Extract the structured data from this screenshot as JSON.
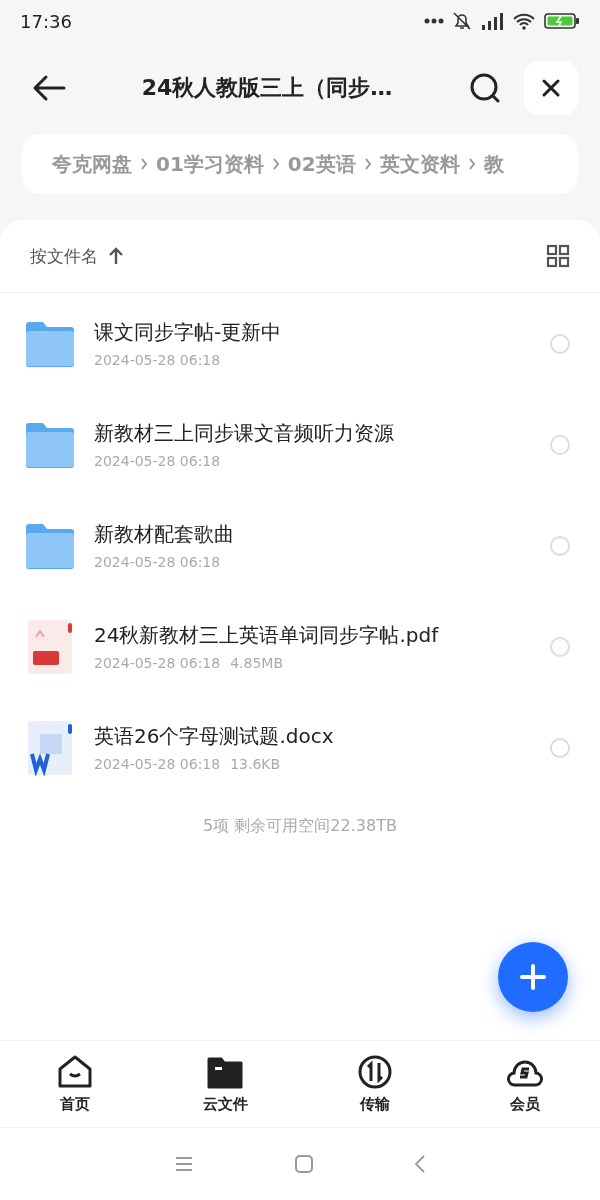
{
  "status_bar": {
    "time": "17:36"
  },
  "header": {
    "title": "24秋人教版三上（同步…"
  },
  "breadcrumb": [
    "夸克网盘",
    "01学习资料",
    "02英语",
    "英文资料",
    "教"
  ],
  "sort": {
    "label": "按文件名"
  },
  "files": [
    {
      "kind": "folder",
      "name": "课文同步字帖-更新中",
      "date": "2024-05-28 06:18",
      "selected": false
    },
    {
      "kind": "folder",
      "name": "新教材三上同步课文音频听力资源",
      "date": "2024-05-28 06:18",
      "selected": false
    },
    {
      "kind": "folder",
      "name": "新教材配套歌曲",
      "date": "2024-05-28 06:18",
      "selected": false
    },
    {
      "kind": "pdf",
      "name": "24秋新教材三上英语单词同步字帖.pdf",
      "date": "2024-05-28 06:18",
      "size": "4.85MB",
      "selected": false
    },
    {
      "kind": "docx",
      "name": "英语26个字母测试题.docx",
      "date": "2024-05-28 06:18",
      "size": "13.6KB",
      "selected": false
    }
  ],
  "summary": "5项 剩余可用空间22.38TB",
  "tabs": [
    {
      "kind": "home",
      "label": "首页",
      "selected": false
    },
    {
      "kind": "files",
      "label": "云文件",
      "selected": true
    },
    {
      "kind": "transfer",
      "label": "传输",
      "selected": false
    },
    {
      "kind": "member",
      "label": "会员",
      "selected": false
    }
  ]
}
